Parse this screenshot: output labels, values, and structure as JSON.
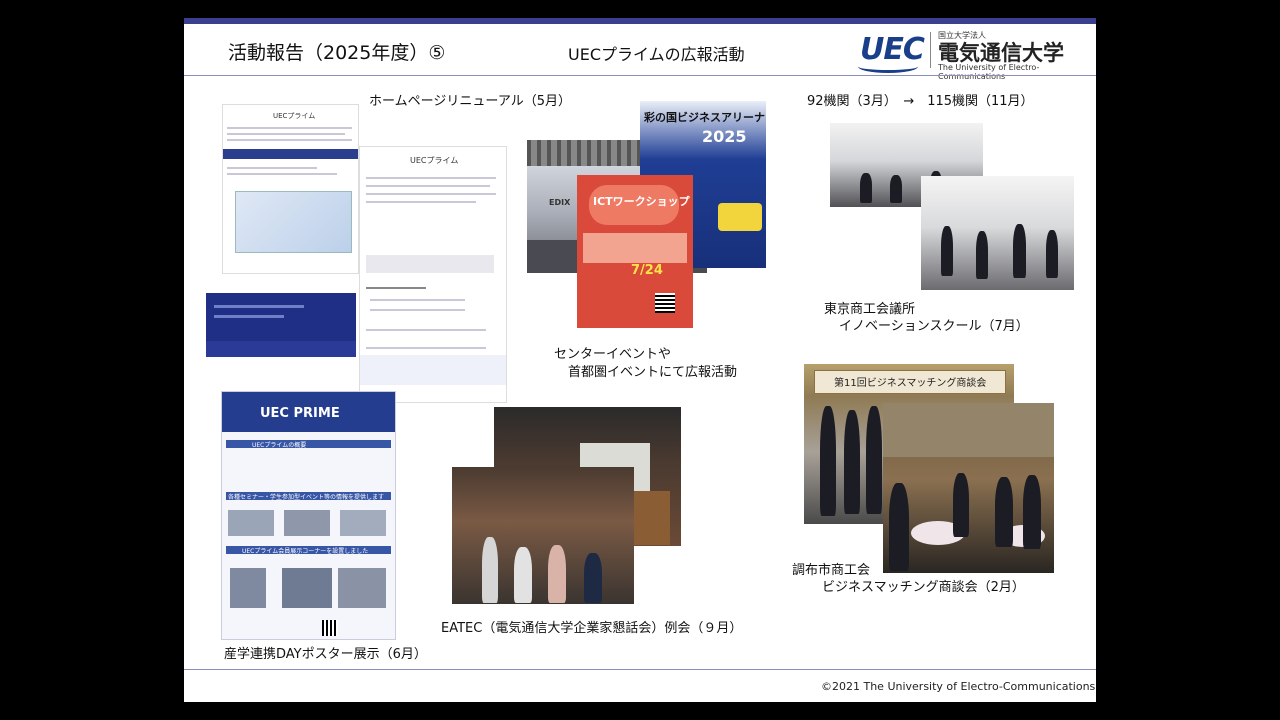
{
  "header": {
    "title": "活動報告（2025年度）⑤",
    "subtitle": "UECプライムの広報活動",
    "logo": {
      "mark": "UEC",
      "small": "国立大学法人",
      "jp": "電気通信大学",
      "en": "The University of Electro-Communications"
    }
  },
  "captions": {
    "homepage": "ホームページリニューアル（5月）",
    "member_count": "92機関（3月）　→　115機関（11月）",
    "event_line1": "センターイベントや",
    "event_line2": "首都圏イベントにて広報活動",
    "tokyo_line1": "東京商工会議所",
    "tokyo_line2": "イノベーションスクール（7月）",
    "chofu_line1": "調布市商工会",
    "chofu_line2": "ビジネスマッチング商談会（2月）",
    "eatec": "EATEC（電気通信大学企業家懇話会）例会（９月）",
    "poster": "産学連携DAYポスター展示（6月）"
  },
  "images": {
    "website_page_title": "UECプライム",
    "website_page_title2": "UECプライム",
    "poster_title": "UEC PRIME",
    "poster_heading1": "UECプライムの概要",
    "poster_heading2": "各種セミナー・学生参加型イベント等の情報を提供します",
    "poster_heading3": "UECプライム会員展示コーナーを設置しました",
    "flyer_arena": "彩の国ビジネスアリーナ",
    "flyer_arena_year": "2025",
    "flyer_ict": "ICTワークショップ",
    "flyer_date": "7/24",
    "chofu_banner": "第11回ビジネスマッチング商談会",
    "hall_sign": "EDIX"
  },
  "footer": {
    "copyright": "©2021 The University of Electro-Communications"
  }
}
